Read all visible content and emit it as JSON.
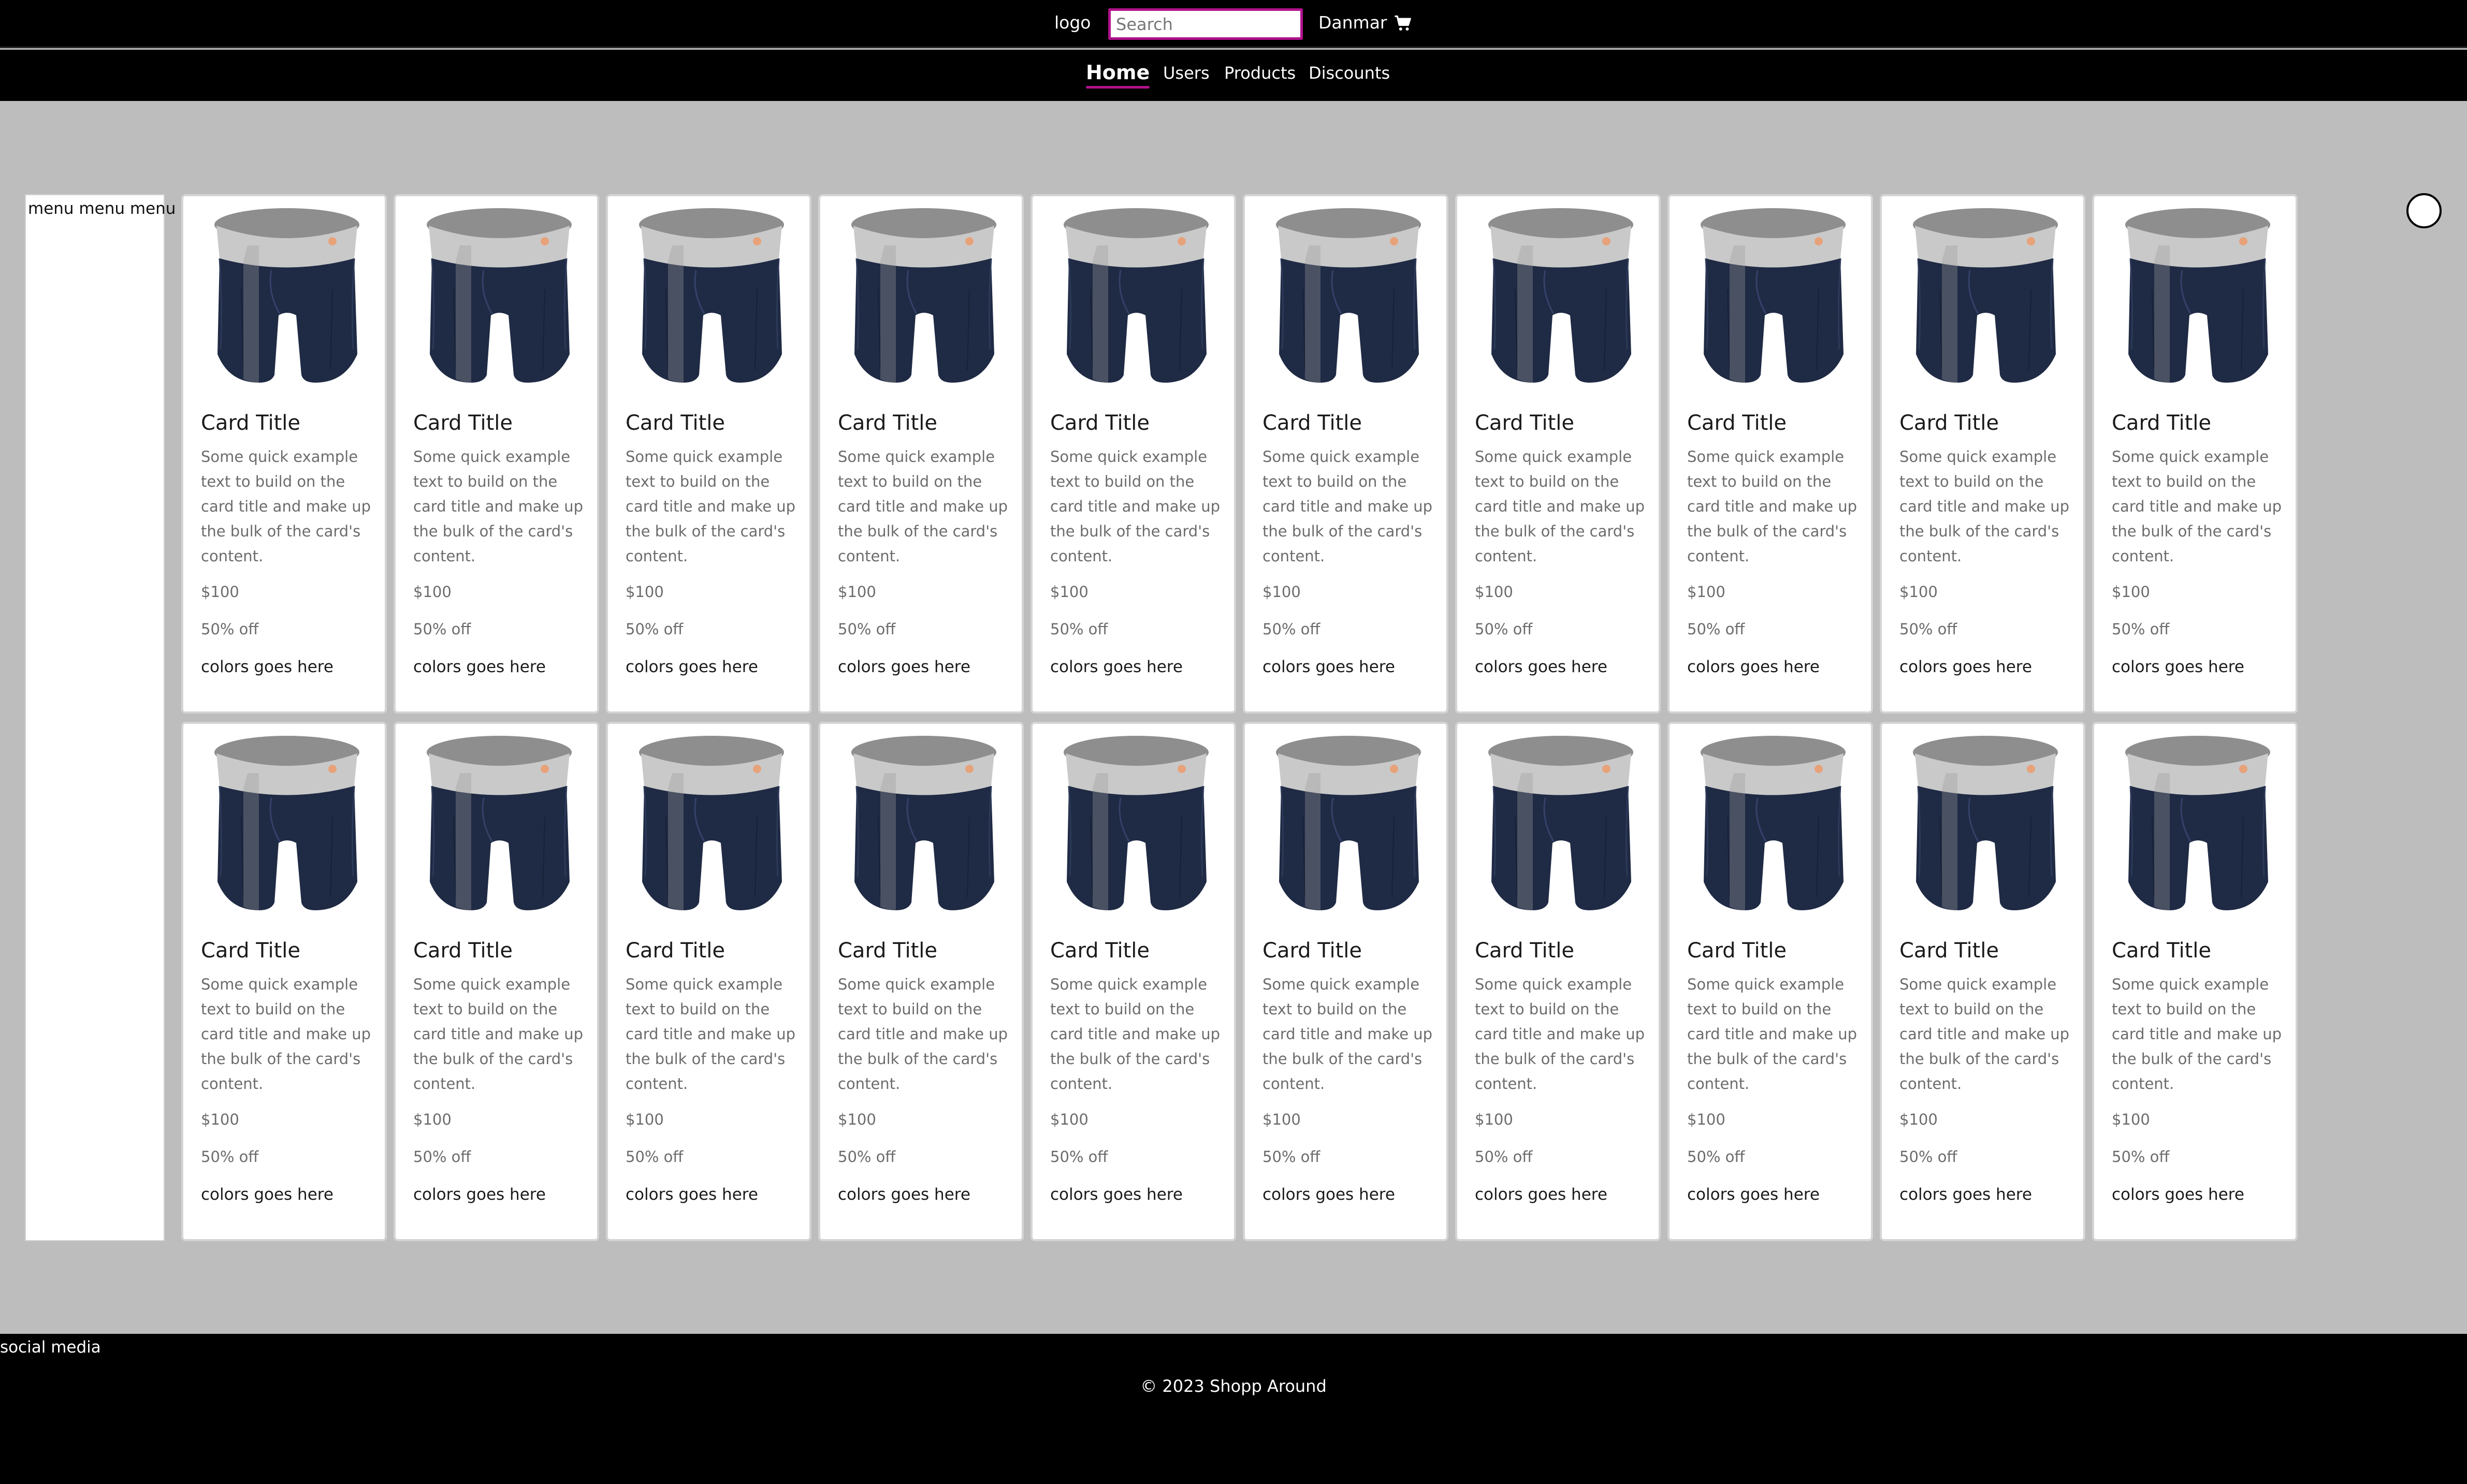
{
  "header": {
    "logo": "logo",
    "search_placeholder": "Search",
    "user": "Danmar",
    "cart_icon": "cart-icon"
  },
  "nav": {
    "items": [
      {
        "label": "Home",
        "active": true
      },
      {
        "label": "Users",
        "active": false
      },
      {
        "label": "Products",
        "active": false
      },
      {
        "label": "Discounts",
        "active": false
      }
    ],
    "accent_color": "#b0128c"
  },
  "sidemenu": {
    "items": [
      "menu menu menu"
    ]
  },
  "cards": [
    {
      "title": "Card Title",
      "text": "Some quick example text to build on the card title and make up the bulk of the card's content.",
      "price": "$100",
      "discount": "50% off",
      "colors": "colors goes here"
    },
    {
      "title": "Card Title",
      "text": "Some quick example text to build on the card title and make up the bulk of the card's content.",
      "price": "$100",
      "discount": "50% off",
      "colors": "colors goes here"
    },
    {
      "title": "Card Title",
      "text": "Some quick example text to build on the card title and make up the bulk of the card's content.",
      "price": "$100",
      "discount": "50% off",
      "colors": "colors goes here"
    },
    {
      "title": "Card Title",
      "text": "Some quick example text to build on the card title and make up the bulk of the card's content.",
      "price": "$100",
      "discount": "50% off",
      "colors": "colors goes here"
    },
    {
      "title": "Card Title",
      "text": "Some quick example text to build on the card title and make up the bulk of the card's content.",
      "price": "$100",
      "discount": "50% off",
      "colors": "colors goes here"
    },
    {
      "title": "Card Title",
      "text": "Some quick example text to build on the card title and make up the bulk of the card's content.",
      "price": "$100",
      "discount": "50% off",
      "colors": "colors goes here"
    },
    {
      "title": "Card Title",
      "text": "Some quick example text to build on the card title and make up the bulk of the card's content.",
      "price": "$100",
      "discount": "50% off",
      "colors": "colors goes here"
    },
    {
      "title": "Card Title",
      "text": "Some quick example text to build on the card title and make up the bulk of the card's content.",
      "price": "$100",
      "discount": "50% off",
      "colors": "colors goes here"
    },
    {
      "title": "Card Title",
      "text": "Some quick example text to build on the card title and make up the bulk of the card's content.",
      "price": "$100",
      "discount": "50% off",
      "colors": "colors goes here"
    },
    {
      "title": "Card Title",
      "text": "Some quick example text to build on the card title and make up the bulk of the card's content.",
      "price": "$100",
      "discount": "50% off",
      "colors": "colors goes here"
    },
    {
      "title": "Card Title",
      "text": "Some quick example text to build on the card title and make up the bulk of the card's content.",
      "price": "$100",
      "discount": "50% off",
      "colors": "colors goes here"
    },
    {
      "title": "Card Title",
      "text": "Some quick example text to build on the card title and make up the bulk of the card's content.",
      "price": "$100",
      "discount": "50% off",
      "colors": "colors goes here"
    },
    {
      "title": "Card Title",
      "text": "Some quick example text to build on the card title and make up the bulk of the card's content.",
      "price": "$100",
      "discount": "50% off",
      "colors": "colors goes here"
    },
    {
      "title": "Card Title",
      "text": "Some quick example text to build on the card title and make up the bulk of the card's content.",
      "price": "$100",
      "discount": "50% off",
      "colors": "colors goes here"
    },
    {
      "title": "Card Title",
      "text": "Some quick example text to build on the card title and make up the bulk of the card's content.",
      "price": "$100",
      "discount": "50% off",
      "colors": "colors goes here"
    },
    {
      "title": "Card Title",
      "text": "Some quick example text to build on the card title and make up the bulk of the card's content.",
      "price": "$100",
      "discount": "50% off",
      "colors": "colors goes here"
    },
    {
      "title": "Card Title",
      "text": "Some quick example text to build on the card title and make up the bulk of the card's content.",
      "price": "$100",
      "discount": "50% off",
      "colors": "colors goes here"
    },
    {
      "title": "Card Title",
      "text": "Some quick example text to build on the card title and make up the bulk of the card's content.",
      "price": "$100",
      "discount": "50% off",
      "colors": "colors goes here"
    },
    {
      "title": "Card Title",
      "text": "Some quick example text to build on the card title and make up the bulk of the card's content.",
      "price": "$100",
      "discount": "50% off",
      "colors": "colors goes here"
    },
    {
      "title": "Card Title",
      "text": "Some quick example text to build on the card title and make up the bulk of the card's content.",
      "price": "$100",
      "discount": "50% off",
      "colors": "colors goes here"
    }
  ],
  "product_image_icon": "boxer-briefs-icon",
  "product_colors": {
    "fabric": "#1f2a44",
    "waistband": "#c9c9c9"
  },
  "footer": {
    "social": "social media",
    "copyright": "© 2023 Shopp Around"
  }
}
